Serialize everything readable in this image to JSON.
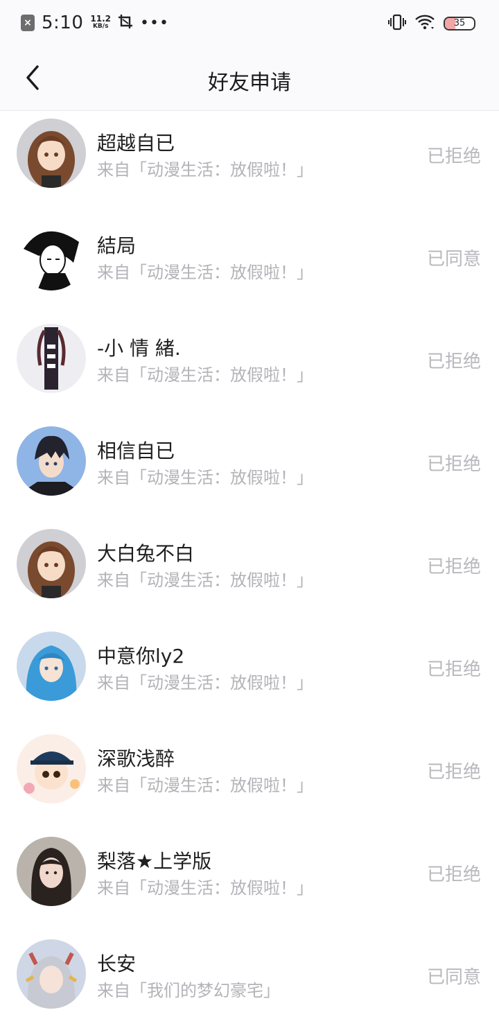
{
  "status_bar": {
    "time": "5:10",
    "speed_value": "11.2",
    "speed_unit": "KB/s",
    "dots": "•••",
    "battery": "35",
    "battery_level": 0.35
  },
  "nav": {
    "title": "好友申请"
  },
  "requests": [
    {
      "name": "超越自已",
      "source": "来自「动漫生活：放假啦！」",
      "status": "已拒绝",
      "avatar": "avatar-brown-hair-girl"
    },
    {
      "name": "結局",
      "source": "来自「动漫生活：放假啦！」",
      "status": "已同意",
      "avatar": "avatar-monochrome-boy"
    },
    {
      "name": "-小 情 緒.",
      "source": "来自「动漫生活：放假啦！」",
      "status": "已拒绝",
      "avatar": "avatar-dark-figure"
    },
    {
      "name": "相信自已",
      "source": "来自「动漫生活：放假啦！」",
      "status": "已拒绝",
      "avatar": "avatar-black-hair-boy"
    },
    {
      "name": "大白兔不白",
      "source": "来自「动漫生活：放假啦！」",
      "status": "已拒绝",
      "avatar": "avatar-brown-hair-girl"
    },
    {
      "name": "中意你ly2",
      "source": "来自「动漫生活：放假啦！」",
      "status": "已拒绝",
      "avatar": "avatar-blue-hair-girl"
    },
    {
      "name": "深歌浅醉",
      "source": "来自「动漫生活：放假啦！」",
      "status": "已拒绝",
      "avatar": "avatar-chibi-cap-boy"
    },
    {
      "name": "梨落★上学版",
      "source": "来自「动漫生活：放假啦！」",
      "status": "已拒绝",
      "avatar": "avatar-photo-girl"
    },
    {
      "name": "长安",
      "source": "来自「我们的梦幻豪宅」",
      "status": "已同意",
      "avatar": "avatar-silver-hair-girl"
    }
  ],
  "colors": {
    "background": "#ffffff",
    "header": "#fafafc",
    "status_text": "#b8b8bd",
    "source_text": "#b3b3b8"
  }
}
